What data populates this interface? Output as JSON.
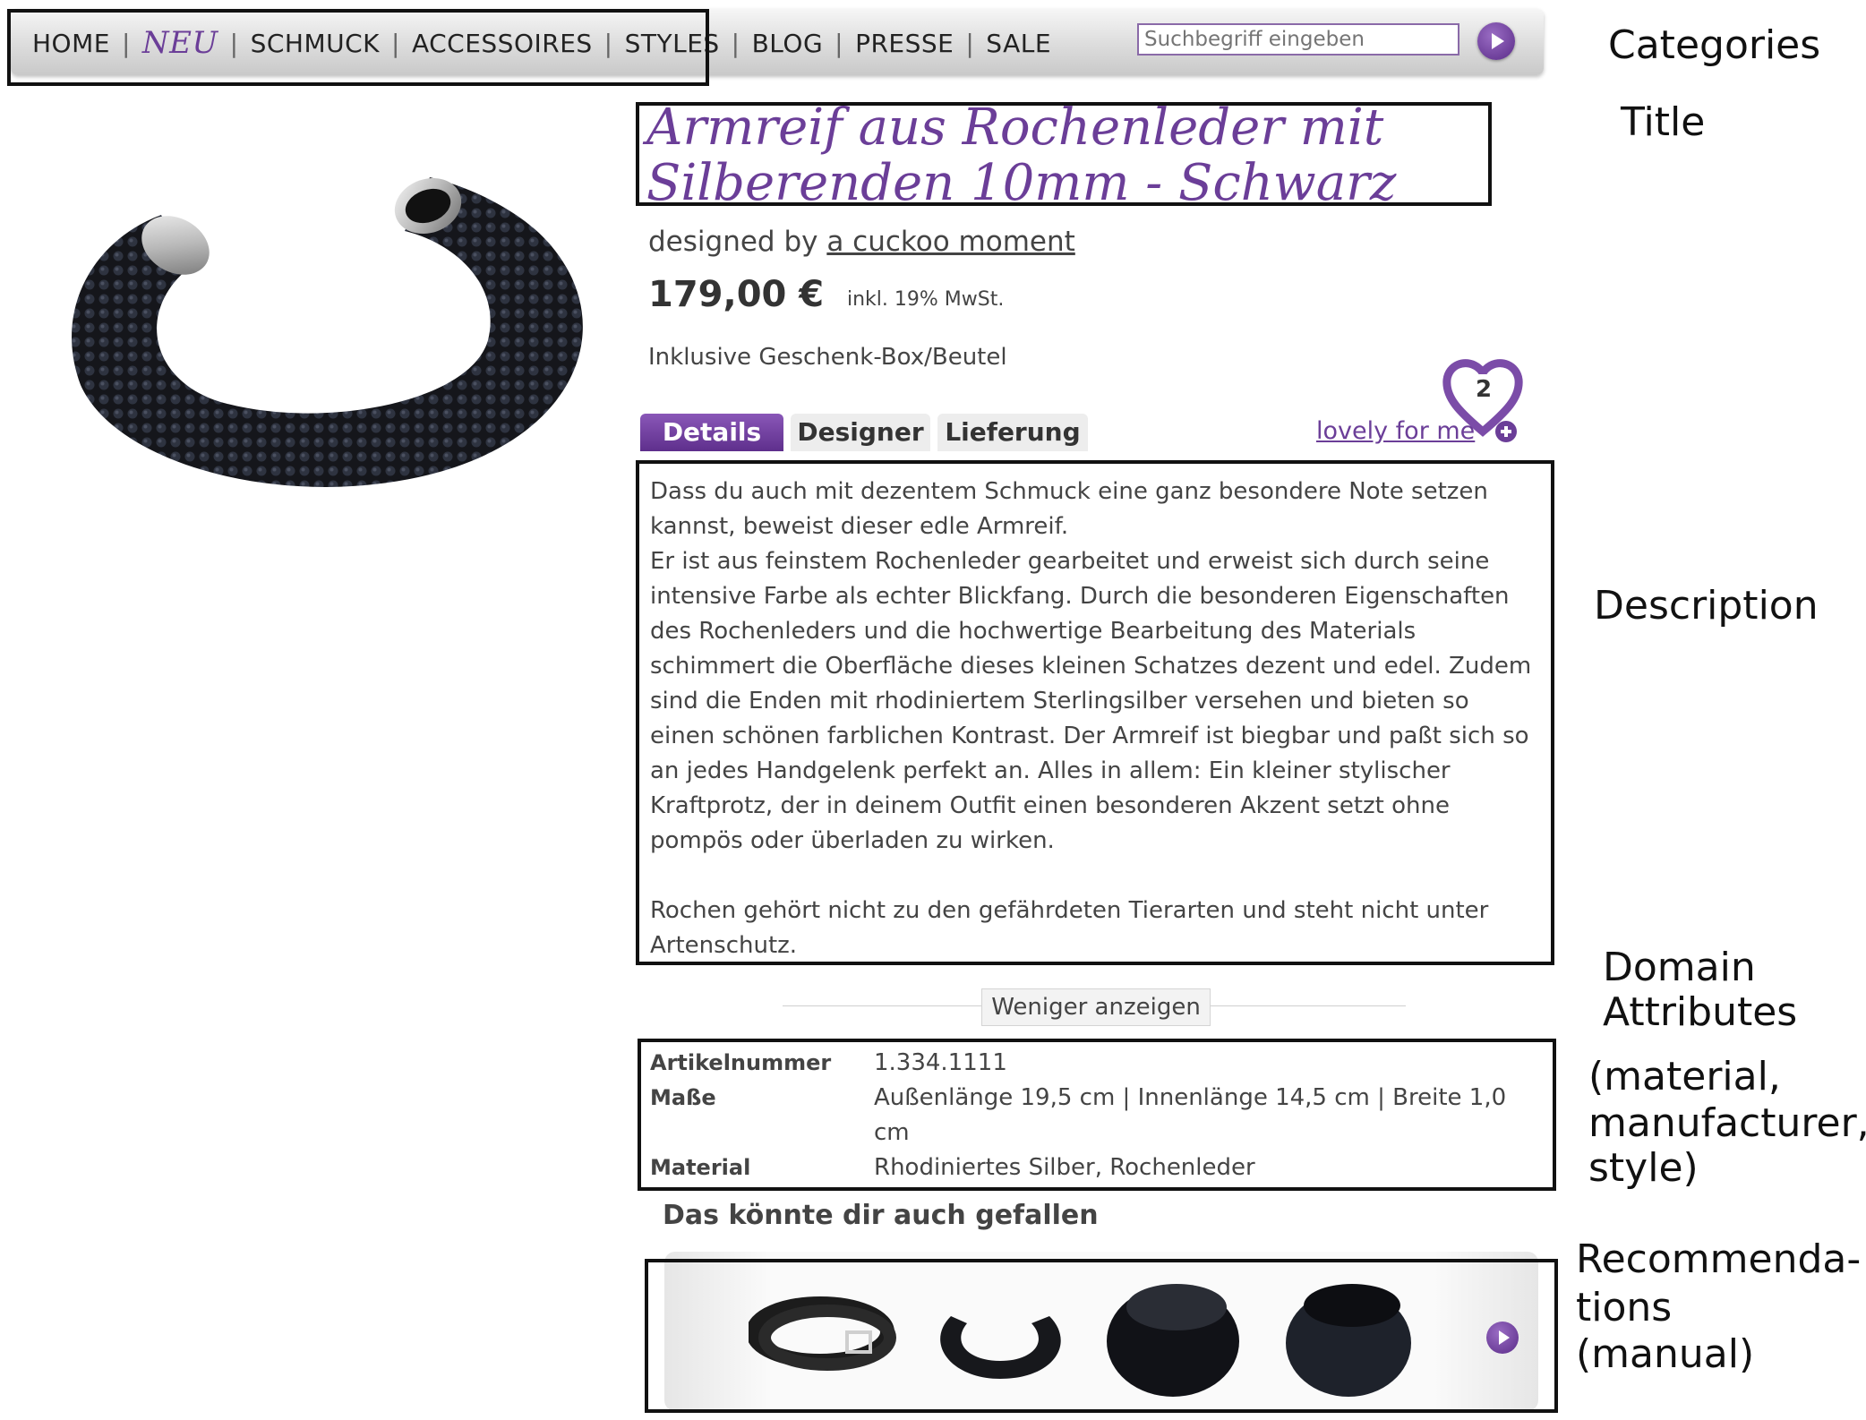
{
  "nav": {
    "items": [
      "HOME",
      "NEU",
      "SCHMUCK",
      "ACCESSOIRES",
      "STYLES",
      "BLOG",
      "PRESSE",
      "SALE"
    ],
    "search_placeholder": "Suchbegriff eingeben"
  },
  "product": {
    "title": "Armreif aus Rochenleder mit Silberenden 10mm - Schwarz",
    "designed_by_prefix": "designed by",
    "designer_name": "a cuckoo moment",
    "price": "179,00 €",
    "vat_note": "inkl. 19% MwSt.",
    "gift_note": "Inklusive Geschenk-Box/Beutel"
  },
  "tabs": {
    "details": "Details",
    "designer": "Designer",
    "lieferung": "Lieferung"
  },
  "wishlist": {
    "label": "lovely for me",
    "count": "2"
  },
  "description": {
    "paragraph1": "Dass du auch mit dezentem Schmuck eine ganz besondere Note setzen kannst, beweist dieser edle Armreif.",
    "paragraph2": "Er ist aus feinstem Rochenleder gearbeitet und erweist sich durch seine intensive Farbe als echter Blickfang. Durch die besonderen Eigenschaften des Rochenleders und die hochwertige Bearbeitung des Materials schimmert die Oberfläche dieses kleinen Schatzes dezent und edel. Zudem sind die Enden mit rhodiniertem Sterlingsilber versehen und bieten so einen schönen farblichen Kontrast. Der Armreif ist biegbar und paßt sich so an jedes Handgelenk perfekt an. Alles in allem: Ein kleiner stylischer Kraftprotz, der in deinem Outfit einen besonderen Akzent setzt ohne pompös oder überladen zu wirken.",
    "paragraph3": "Rochen gehört nicht zu den gefährdeten Tierarten und steht nicht unter Artenschutz."
  },
  "less_button": "Weniger anzeigen",
  "attributes": [
    {
      "key": "Artikelnummer",
      "value": "1.334.1111"
    },
    {
      "key": "Maße",
      "value": "Außenlänge 19,5 cm | Innenlänge 14,5 cm | Breite 1,0 cm"
    },
    {
      "key": "Material",
      "value": "Rhodiniertes Silber, Rochenleder"
    }
  ],
  "recommendations": {
    "heading": "Das könnte dir auch gefallen"
  },
  "annotations": {
    "categories": "Categories",
    "title": "Title",
    "description": "Description",
    "domain_attributes_line1": "Domain",
    "domain_attributes_line2": "Attributes",
    "domain_sub_line1": "(material,",
    "domain_sub_line2": "manufacturer,",
    "domain_sub_line3": "style)",
    "recs_line1": "Recommenda-",
    "recs_line2": "tions",
    "recs_line3": "(manual)"
  },
  "colors": {
    "accent": "#6b3e98",
    "nav_bg": "#dcdcdc"
  }
}
